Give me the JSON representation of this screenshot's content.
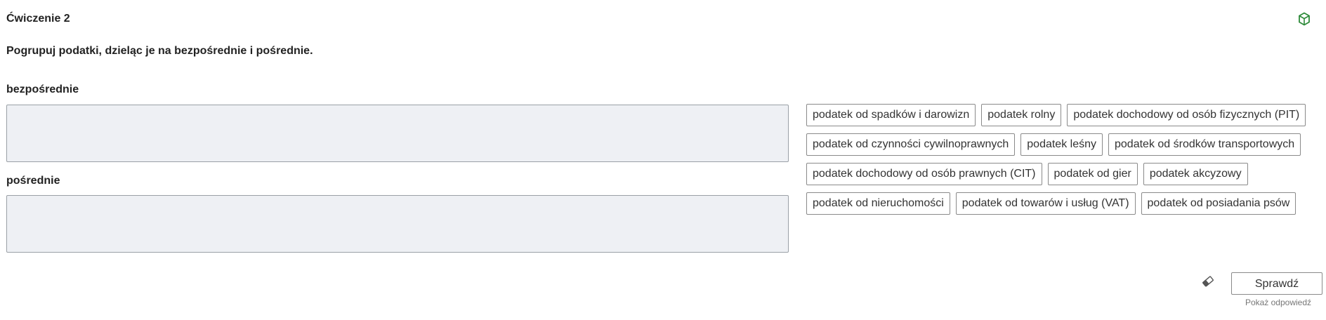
{
  "exercise": {
    "title": "Ćwiczenie 2",
    "instruction": "Pogrupuj podatki, dzieląc je na bezpośrednie i pośrednie."
  },
  "groups": [
    {
      "label": "bezpośrednie"
    },
    {
      "label": "pośrednie"
    }
  ],
  "tags": [
    "podatek od spadków i darowizn",
    "podatek rolny",
    "podatek dochodowy od osób fizycznych (PIT)",
    "podatek od czynności cywilnoprawnych",
    "podatek leśny",
    "podatek od środków transportowych",
    "podatek dochodowy od osób prawnych (CIT)",
    "podatek od gier",
    "podatek akcyzowy",
    "podatek od nieruchomości",
    "podatek od towarów i usług (VAT)",
    "podatek od posiadania psów"
  ],
  "actions": {
    "check_label": "Sprawdź",
    "show_answer_label": "Pokaż odpowiedź"
  },
  "icons": {
    "cube": "cube-icon",
    "eraser": "eraser-icon"
  },
  "colors": {
    "cube_icon": "#2e8b3a",
    "drop_zone_bg": "#eef0f4",
    "border": "#8a8a8a"
  }
}
